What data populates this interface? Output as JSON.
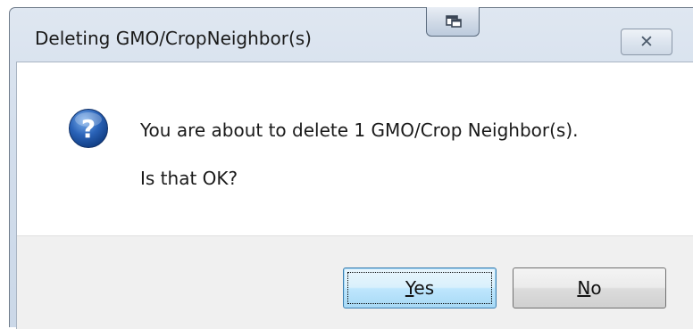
{
  "window": {
    "title": "Deleting GMO/CropNeighbor(s)",
    "close_symbol": "✕"
  },
  "message": {
    "line1": "You are about to delete 1 GMO/Crop Neighbor(s).",
    "line2": "Is that OK?",
    "icon": "question-icon"
  },
  "buttons": {
    "yes_label": "Yes",
    "no_label": "No"
  },
  "icons": {
    "app_icon": "window-restore-icon",
    "close_icon": "close-icon"
  },
  "colors": {
    "question_icon_blue": "#2a63b8",
    "default_button_border": "#3c7fb1"
  }
}
